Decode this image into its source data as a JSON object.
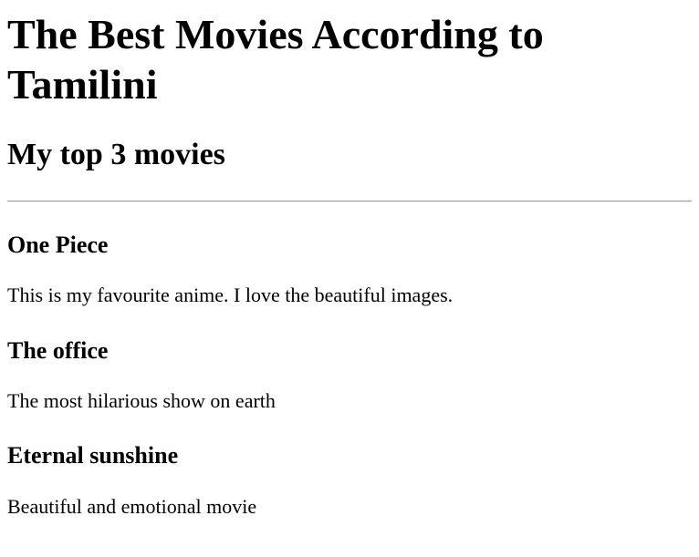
{
  "page": {
    "title": "The Best Movies According to Tamilini",
    "subtitle": "My top 3 movies"
  },
  "movies": [
    {
      "title": "One Piece",
      "description": "This is my favourite anime. I love the beautiful images."
    },
    {
      "title": "The office",
      "description": "The most hilarious show on earth"
    },
    {
      "title": "Eternal sunshine",
      "description": "Beautiful and emotional movie"
    }
  ]
}
